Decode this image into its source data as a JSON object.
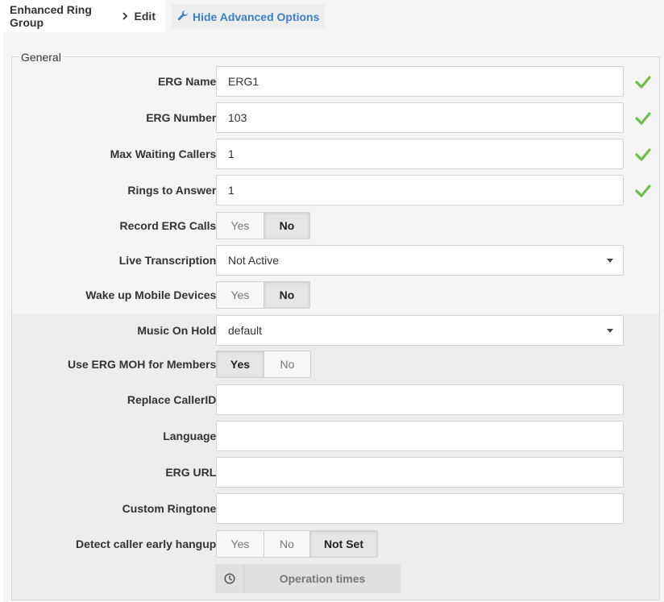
{
  "breadcrumb": {
    "parent": "Enhanced Ring Group",
    "current": "Edit"
  },
  "toolbar": {
    "advanced_label": "Hide Advanced Options"
  },
  "section": {
    "legend": "General"
  },
  "fields": {
    "erg_name": {
      "label": "ERG Name:",
      "value": "ERG1",
      "valid": true
    },
    "erg_number": {
      "label": "ERG Number:",
      "value": "103",
      "valid": true
    },
    "max_waiting": {
      "label": "Max Waiting Callers:",
      "value": "1",
      "valid": true
    },
    "rings_to_answer": {
      "label": "Rings to Answer:",
      "value": "1",
      "valid": true
    },
    "record_calls": {
      "label": "Record ERG Calls:",
      "options": [
        "Yes",
        "No"
      ],
      "selected": "No"
    },
    "live_transcription": {
      "label": "Live Transcription:",
      "value": "Not Active"
    },
    "wake_mobile": {
      "label": "Wake up Mobile Devices:",
      "options": [
        "Yes",
        "No"
      ],
      "selected": "No"
    },
    "music_on_hold": {
      "label": "Music On Hold:",
      "value": "default"
    },
    "use_erg_moh": {
      "label": "Use ERG MOH for Members:",
      "options": [
        "Yes",
        "No"
      ],
      "selected": "Yes"
    },
    "replace_callerid": {
      "label": "Replace CallerID:",
      "value": ""
    },
    "language": {
      "label": "Language:",
      "value": ""
    },
    "erg_url": {
      "label": "ERG URL:",
      "value": ""
    },
    "custom_ringtone": {
      "label": "Custom Ringtone:",
      "value": ""
    },
    "detect_hangup": {
      "label": "Detect caller early hangup:",
      "options": [
        "Yes",
        "No",
        "Not Set"
      ],
      "selected": "Not Set"
    }
  },
  "operation_times": {
    "label": "Operation times",
    "icon": "clock-icon"
  },
  "colors": {
    "accent": "#3a7fc8",
    "valid": "#6cc04a"
  }
}
